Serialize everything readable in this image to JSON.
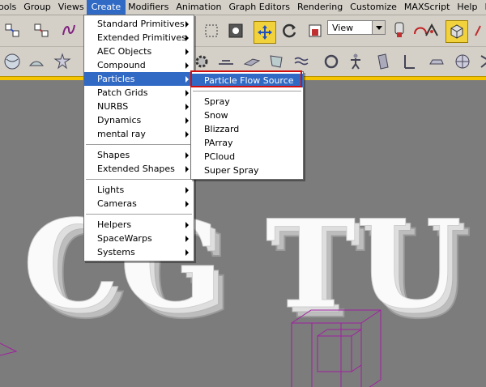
{
  "menubar": {
    "items": [
      "ools",
      "Group",
      "Views",
      "Create",
      "Modifiers",
      "Animation",
      "Graph Editors",
      "Rendering",
      "Customize",
      "MAXScript",
      "Help",
      "Di-O-Mat"
    ],
    "active_index": 3
  },
  "toolbar": {
    "view_select_value": "View"
  },
  "create_menu": {
    "groups": [
      [
        {
          "label": "Standard Primitives",
          "submenu": true
        },
        {
          "label": "Extended Primitives",
          "submenu": true
        },
        {
          "label": "AEC Objects",
          "submenu": true
        },
        {
          "label": "Compound",
          "submenu": true
        },
        {
          "label": "Particles",
          "submenu": true,
          "highlighted": true
        },
        {
          "label": "Patch Grids",
          "submenu": true
        },
        {
          "label": "NURBS",
          "submenu": true
        },
        {
          "label": "Dynamics",
          "submenu": true
        },
        {
          "label": "mental ray",
          "submenu": true
        }
      ],
      [
        {
          "label": "Shapes",
          "submenu": true
        },
        {
          "label": "Extended Shapes",
          "submenu": true
        }
      ],
      [
        {
          "label": "Lights",
          "submenu": true
        },
        {
          "label": "Cameras",
          "submenu": true
        }
      ],
      [
        {
          "label": "Helpers",
          "submenu": true
        },
        {
          "label": "SpaceWarps",
          "submenu": true
        },
        {
          "label": "Systems",
          "submenu": true
        }
      ]
    ]
  },
  "particles_submenu": {
    "groups": [
      [
        {
          "label": "Particle Flow Source",
          "highlighted": true
        }
      ],
      [
        {
          "label": "Spray"
        },
        {
          "label": "Snow"
        },
        {
          "label": "Blizzard"
        },
        {
          "label": "PArray"
        },
        {
          "label": "PCloud"
        },
        {
          "label": "Super Spray"
        }
      ]
    ]
  },
  "viewport": {
    "text_3d": "CG TU",
    "bg_color": "#7c7c7c",
    "helper_color": "#a020a0"
  }
}
